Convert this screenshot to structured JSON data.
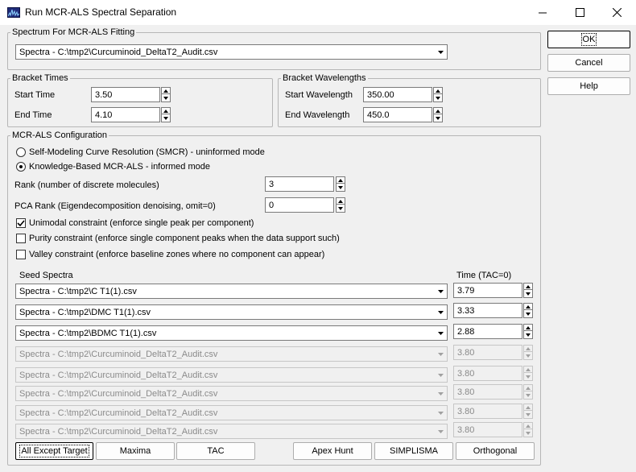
{
  "window": {
    "title": "Run MCR-ALS Spectral Separation",
    "app_icon": "spectrum-app-icon",
    "controls": [
      "minimize-icon",
      "maximize-icon",
      "close-icon"
    ]
  },
  "spectrum_group": {
    "legend": "Spectrum For MCR-ALS Fitting",
    "selected": "Spectra - C:\\tmp2\\Curcuminoid_DeltaT2_Audit.csv"
  },
  "bracket_times": {
    "legend": "Bracket Times",
    "start_label": "Start Time",
    "start_value": "3.50",
    "end_label": "End Time",
    "end_value": "4.10"
  },
  "bracket_wavelengths": {
    "legend": "Bracket Wavelengths",
    "start_label": "Start Wavelength",
    "start_value": "350.00",
    "end_label": "End Wavelength",
    "end_value": "450.0"
  },
  "config": {
    "legend": "MCR-ALS Configuration",
    "mode_smcr": "Self-Modeling Curve Resolution (SMCR) - uninformed mode",
    "mode_kb": "Knowledge-Based MCR-ALS - informed mode",
    "selected_mode": "kb",
    "rank_label": "Rank (number of discrete molecules)",
    "rank_value": "3",
    "pca_label": "PCA Rank (Eigendecomposition denoising, omit=0)",
    "pca_value": "0",
    "unimodal_label": "Unimodal constraint (enforce single peak per component)",
    "unimodal_checked": true,
    "purity_label": "Purity constraint (enforce single component peaks when the data support such)",
    "purity_checked": false,
    "valley_label": "Valley constraint (enforce baseline zones where no component can appear)",
    "valley_checked": false,
    "seed_header": "Seed Spectra",
    "time_header": "Time (TAC=0)",
    "seeds": [
      {
        "spectrum": "Spectra - C:\\tmp2\\C T1(1).csv",
        "time": "3.79",
        "enabled": true
      },
      {
        "spectrum": "Spectra - C:\\tmp2\\DMC T1(1).csv",
        "time": "3.33",
        "enabled": true
      },
      {
        "spectrum": "Spectra - C:\\tmp2\\BDMC T1(1).csv",
        "time": "2.88",
        "enabled": true
      },
      {
        "spectrum": "Spectra - C:\\tmp2\\Curcuminoid_DeltaT2_Audit.csv",
        "time": "3.80",
        "enabled": false
      },
      {
        "spectrum": "Spectra - C:\\tmp2\\Curcuminoid_DeltaT2_Audit.csv",
        "time": "3.80",
        "enabled": false
      },
      {
        "spectrum": "Spectra - C:\\tmp2\\Curcuminoid_DeltaT2_Audit.csv",
        "time": "3.80",
        "enabled": false
      },
      {
        "spectrum": "Spectra - C:\\tmp2\\Curcuminoid_DeltaT2_Audit.csv",
        "time": "3.80",
        "enabled": false
      },
      {
        "spectrum": "Spectra - C:\\tmp2\\Curcuminoid_DeltaT2_Audit.csv",
        "time": "3.80",
        "enabled": false
      }
    ]
  },
  "buttons": {
    "ok": "OK",
    "cancel": "Cancel",
    "help": "Help",
    "all_except_target": "All Except Target",
    "maxima": "Maxima",
    "tac": "TAC",
    "apex_hunt": "Apex Hunt",
    "simplisma": "SIMPLISMA",
    "orthogonal": "Orthogonal"
  }
}
